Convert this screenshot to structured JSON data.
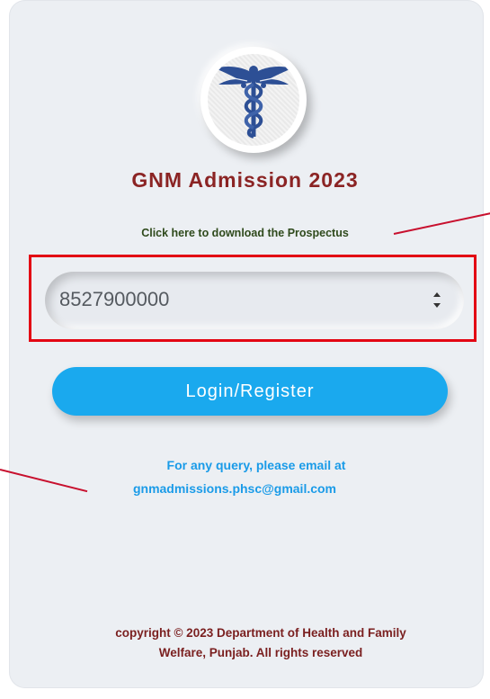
{
  "app": {
    "title": "GNM Admission 2023",
    "prospectus_link": "Click here to download the Prospectus",
    "logo_icon": "caduceus-icon"
  },
  "form": {
    "phone_value": "8527900000",
    "login_button": "Login/Register"
  },
  "contact": {
    "query_text": "For any query, please email at",
    "email": "gnmadmissions.phsc@gmail.com"
  },
  "footer": {
    "copyright_line1": "copyright © 2023 Department of Health and Family",
    "copyright_line2": "Welfare, Punjab. All rights reserved"
  },
  "colors": {
    "title": "#8b2424",
    "accent_blue": "#1aa9ee",
    "highlight_red": "#e30613",
    "card_bg": "#eceff3"
  }
}
